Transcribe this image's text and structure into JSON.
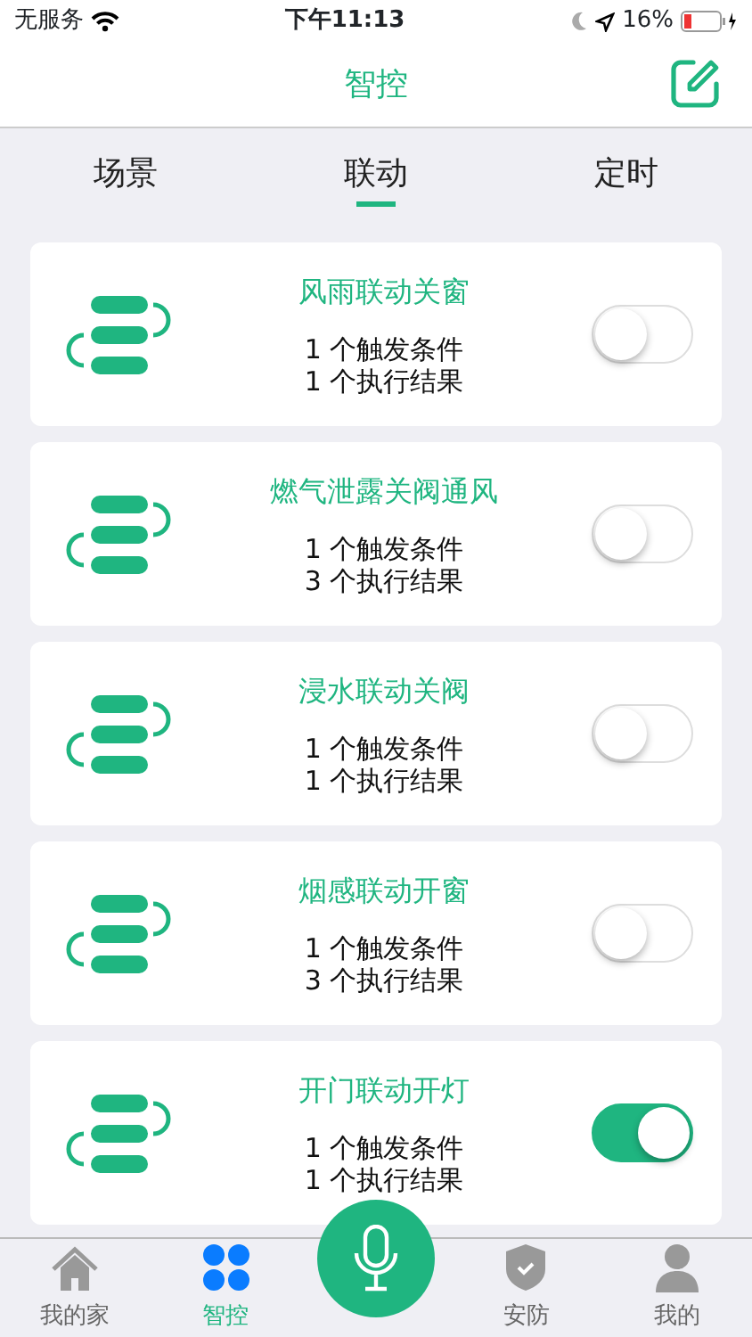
{
  "status_bar": {
    "carrier": "无服务",
    "time": "下午11:13",
    "battery": "16%"
  },
  "header": {
    "title": "智控"
  },
  "tabs": [
    {
      "label": "场景",
      "selected": false
    },
    {
      "label": "联动",
      "selected": true
    },
    {
      "label": "定时",
      "selected": false
    }
  ],
  "rules": [
    {
      "name": "风雨联动关窗",
      "triggers": "1 个触发条件",
      "results": "1 个执行结果",
      "on": false
    },
    {
      "name": "燃气泄露关阀通风",
      "triggers": "1 个触发条件",
      "results": "3 个执行结果",
      "on": false
    },
    {
      "name": "浸水联动关阀",
      "triggers": "1 个触发条件",
      "results": "1 个执行结果",
      "on": false
    },
    {
      "name": "烟感联动开窗",
      "triggers": "1 个触发条件",
      "results": "3 个执行结果",
      "on": false
    },
    {
      "name": "开门联动开灯",
      "triggers": "1 个触发条件",
      "results": "1 个执行结果",
      "on": true
    }
  ],
  "bottom_nav": [
    {
      "kind": "home",
      "label": "我的家",
      "selected": false
    },
    {
      "kind": "control",
      "label": "智控",
      "selected": true
    },
    {
      "kind": "voice"
    },
    {
      "kind": "security",
      "label": "安防",
      "selected": false
    },
    {
      "kind": "profile",
      "label": "我的",
      "selected": false
    }
  ]
}
